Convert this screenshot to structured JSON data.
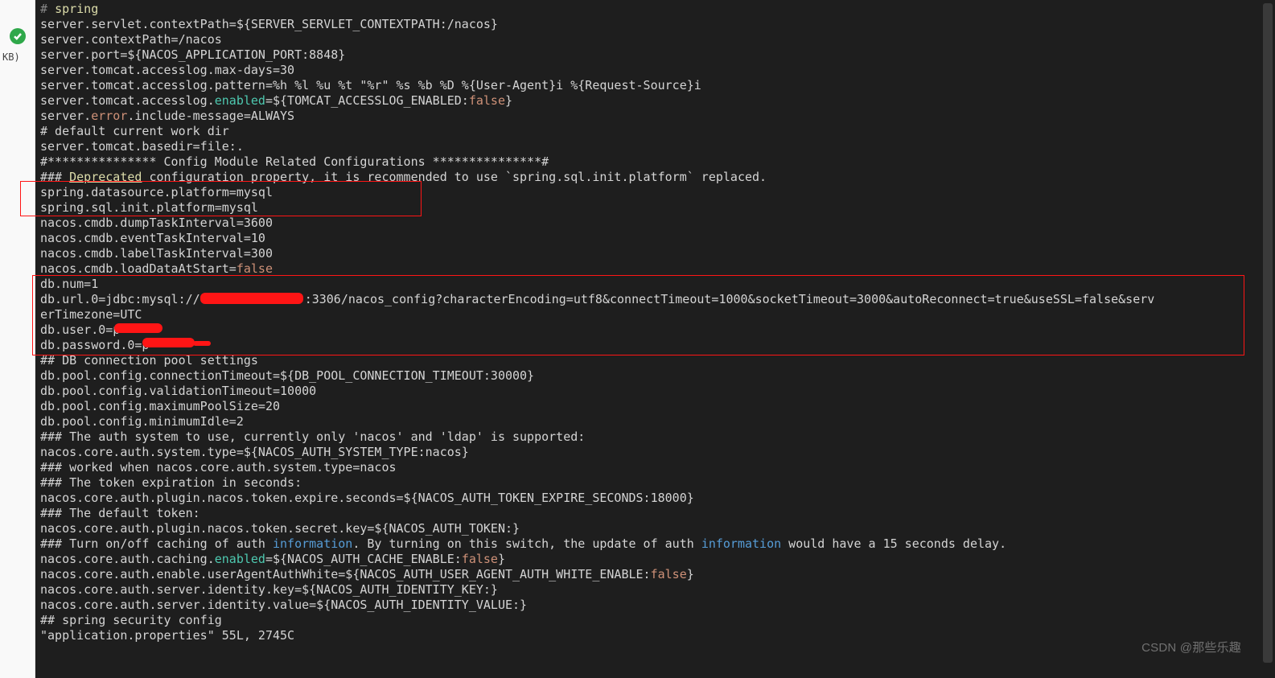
{
  "gutter": {
    "kb_label": "KB)"
  },
  "watermark": "CSDN @那些乐趣",
  "code": {
    "l1_hash": "# ",
    "l1_word": "spring",
    "l2": "server.servlet.contextPath=${SERVER_SERVLET_CONTEXTPATH:/nacos}",
    "l3": "server.contextPath=/nacos",
    "l4": "server.port=${NACOS_APPLICATION_PORT:8848}",
    "l5": "server.tomcat.accesslog.max-days=30",
    "l6": "server.tomcat.accesslog.pattern=%h %l %u %t \"%r\" %s %b %D %{User-Agent}i %{Request-Source}i",
    "l7a": "server.tomcat.accesslog.",
    "l7b": "enabled",
    "l7c": "=${TOMCAT_ACCESSLOG_ENABLED:",
    "l7d": "false",
    "l7e": "}",
    "l8a": "server.",
    "l8b": "error",
    "l8c": ".include-message=ALWAYS",
    "l9": "# default current work dir",
    "l10": "server.tomcat.basedir=file:.",
    "l11": "#*************** Config Module Related Configurations ***************#",
    "l12a": "### ",
    "l12b": "Deprecated",
    "l12c": " configuration property, it is recommended to use `spring.sql.init.platform` replaced.",
    "l13": "spring.datasource.platform=mysql",
    "l14": "spring.sql.init.platform=mysql",
    "l15": "nacos.cmdb.dumpTaskInterval=3600",
    "l16": "nacos.cmdb.eventTaskInterval=10",
    "l17": "nacos.cmdb.labelTaskInterval=300",
    "l18a": "nacos.cmdb.loadDataAtStart=",
    "l18b": "false",
    "l19": "db.num=1",
    "l20a": "db.url.0=jdbc:mysql://",
    "l20b": ":3306/nacos_config?characterEncoding=utf8&connectTimeout=1000&socketTimeout=3000&autoReconnect=true&useSSL=false&serv",
    "l21": "erTimezone=UTC",
    "l22": "db.user.0=p",
    "l23": "db.password.0=p",
    "l24": "## DB connection pool settings",
    "l25": "db.pool.config.connectionTimeout=${DB_POOL_CONNECTION_TIMEOUT:30000}",
    "l26": "db.pool.config.validationTimeout=10000",
    "l27": "db.pool.config.maximumPoolSize=20",
    "l28": "db.pool.config.minimumIdle=2",
    "l29": "### The auth system to use, currently only 'nacos' and 'ldap' is supported:",
    "l30": "nacos.core.auth.system.type=${NACOS_AUTH_SYSTEM_TYPE:nacos}",
    "l31": "### worked when nacos.core.auth.system.type=nacos",
    "l32": "### The token expiration in seconds:",
    "l33": "nacos.core.auth.plugin.nacos.token.expire.seconds=${NACOS_AUTH_TOKEN_EXPIRE_SECONDS:18000}",
    "l34": "### The default token:",
    "l35": "nacos.core.auth.plugin.nacos.token.secret.key=${NACOS_AUTH_TOKEN:}",
    "l36a": "### Turn on/off caching of auth ",
    "l36b": "information",
    "l36c": ". By turning on this switch, the update of auth ",
    "l36d": "information",
    "l36e": " would have a 15 seconds delay.",
    "l37a": "nacos.core.auth.caching.",
    "l37b": "enabled",
    "l37c": "=${NACOS_AUTH_CACHE_ENABLE:",
    "l37d": "false",
    "l37e": "}",
    "l38a": "nacos.core.auth.enable.userAgentAuthWhite=${NACOS_AUTH_USER_AGENT_AUTH_WHITE_ENABLE:",
    "l38b": "false",
    "l38c": "}",
    "l39": "nacos.core.auth.server.identity.key=${NACOS_AUTH_IDENTITY_KEY:}",
    "l40": "nacos.core.auth.server.identity.value=${NACOS_AUTH_IDENTITY_VALUE:}",
    "l41": "## spring security config",
    "l42": "\"application.properties\" 55L, 2745C"
  }
}
